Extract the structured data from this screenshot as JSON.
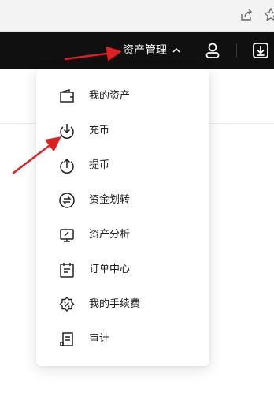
{
  "topnav": {
    "asset_menu_label": "资产管理"
  },
  "dropdown": {
    "items": [
      {
        "label": "我的资产",
        "icon": "wallet-icon"
      },
      {
        "label": "充币",
        "icon": "deposit-icon"
      },
      {
        "label": "提币",
        "icon": "withdraw-icon"
      },
      {
        "label": "资金划转",
        "icon": "transfer-icon"
      },
      {
        "label": "资产分析",
        "icon": "analysis-icon"
      },
      {
        "label": "订单中心",
        "icon": "orders-icon"
      },
      {
        "label": "我的手续费",
        "icon": "fee-icon"
      },
      {
        "label": "审计",
        "icon": "audit-icon"
      }
    ]
  },
  "colors": {
    "nav_background": "#101010",
    "annotation_arrow": "#e02020"
  }
}
